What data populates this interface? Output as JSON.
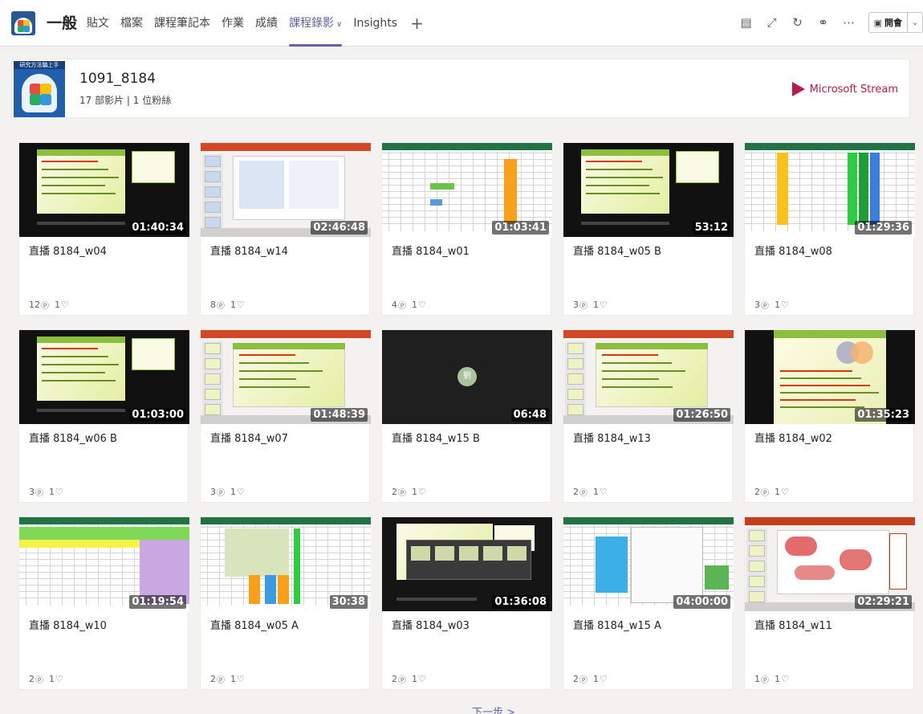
{
  "topbar": {
    "channel": "一般",
    "tabs": [
      {
        "label": "貼文"
      },
      {
        "label": "檔案"
      },
      {
        "label": "課程筆記本"
      },
      {
        "label": "作業"
      },
      {
        "label": "成績"
      },
      {
        "label": "課程錄影",
        "active": true
      },
      {
        "label": "Insights"
      }
    ],
    "add_tab": "+",
    "meet_label": "開會",
    "icons": [
      "conversation-icon",
      "expand-icon",
      "refresh-icon",
      "globe-icon",
      "more-icon",
      "camera-icon"
    ]
  },
  "course": {
    "logo_banner": "研究方法騙上手",
    "name": "1091_8184",
    "meta": "17 部影片 | 1 位粉絲",
    "brand": "Microsoft Stream"
  },
  "videos": [
    {
      "title": "直播 8184_w04",
      "duration": "01:40:34",
      "views": "12",
      "likes": "1",
      "style": "green-slide"
    },
    {
      "title": "直播 8184_w14",
      "duration": "02:46:48",
      "views": "8",
      "likes": "1",
      "style": "ppt-editor"
    },
    {
      "title": "直播 8184_w01",
      "duration": "01:03:41",
      "views": "4",
      "likes": "1",
      "style": "excel"
    },
    {
      "title": "直播 8184_w05 B",
      "duration": "53:12",
      "views": "3",
      "likes": "1",
      "style": "green-slide"
    },
    {
      "title": "直播 8184_w08",
      "duration": "01:29:36",
      "views": "3",
      "likes": "1",
      "style": "excel-color"
    },
    {
      "title": "直播 8184_w06 B",
      "duration": "01:03:00",
      "views": "3",
      "likes": "1",
      "style": "green-slide"
    },
    {
      "title": "直播 8184_w07",
      "duration": "01:48:39",
      "views": "3",
      "likes": "1",
      "style": "ppt-editor-green"
    },
    {
      "title": "直播 8184_w15 B",
      "duration": "06:48",
      "views": "2",
      "likes": "1",
      "style": "blank-avatar",
      "avatar": "劉"
    },
    {
      "title": "直播 8184_w13",
      "duration": "01:26:50",
      "views": "2",
      "likes": "1",
      "style": "ppt-editor-green"
    },
    {
      "title": "直播 8184_w02",
      "duration": "01:35:23",
      "views": "2",
      "likes": "1",
      "style": "green-slide-big"
    },
    {
      "title": "直播 8184_w10",
      "duration": "01:19:54",
      "views": "2",
      "likes": "1",
      "style": "excel-yellow"
    },
    {
      "title": "直播 8184_w05 A",
      "duration": "30:38",
      "views": "2",
      "likes": "1",
      "style": "excel-color2"
    },
    {
      "title": "直播 8184_w03",
      "duration": "01:36:08",
      "views": "2",
      "likes": "1",
      "style": "dark-slides"
    },
    {
      "title": "直播 8184_w15 A",
      "duration": "04:00:00",
      "views": "2",
      "likes": "1",
      "style": "excel-blue"
    },
    {
      "title": "直播 8184_w11",
      "duration": "02:29:21",
      "views": "1",
      "likes": "1",
      "style": "ppt-red"
    }
  ],
  "pager": {
    "next": "下一步 >"
  }
}
